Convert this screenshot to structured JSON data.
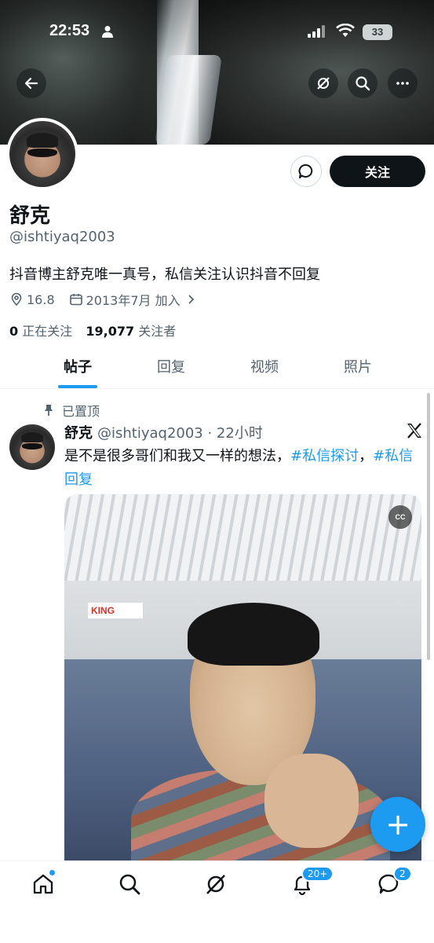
{
  "status_bar": {
    "time": "22:53",
    "battery": "33"
  },
  "profile": {
    "name": "舒克",
    "handle": "@ishtiyaq2003",
    "bio": "抖音博主舒克唯一真号，私信关注认识抖音不回复",
    "location": "16.8",
    "joined": "2013年7月 加入",
    "following_count": "0",
    "following_label": "正在关注",
    "followers_count": "19,077",
    "followers_label": "关注者",
    "follow_button": "关注"
  },
  "tabs": [
    "帖子",
    "回复",
    "视频",
    "照片"
  ],
  "post": {
    "pinned_label": "已置顶",
    "author": "舒克",
    "handle_time": "@ishtiyaq2003 · 22小时",
    "text_plain": "是不是很多哥们和我又一样的想法，",
    "tag1": "#私信探讨",
    "separator": "，",
    "tag2": "#私信回复",
    "media_cc": "CC",
    "media_sign": "KING"
  },
  "nav": {
    "notifications_badge": "20+",
    "messages_badge": "2"
  },
  "fab": {
    "label": "+"
  },
  "colors": {
    "accent": "#1d9bf0",
    "text": "#0f1419",
    "secondary": "#536471"
  }
}
